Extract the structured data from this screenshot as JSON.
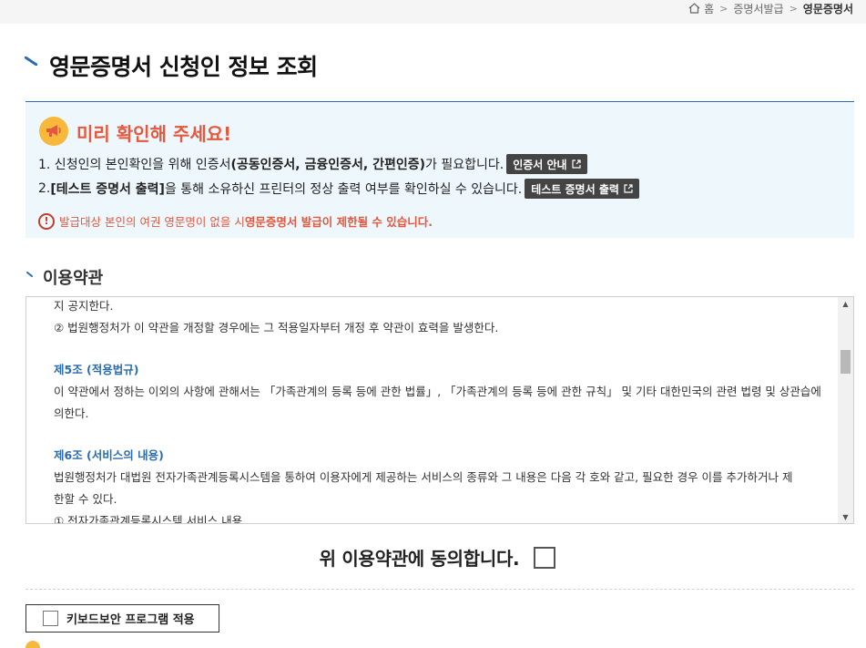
{
  "breadcrumb": {
    "home": "홈",
    "level1": "증명서발급",
    "current": "영문증명서"
  },
  "page": {
    "title": "영문증명서 신청인 정보 조회"
  },
  "notice": {
    "title": "미리 확인해 주세요!",
    "line1_prefix": "1. 신청인의 본인확인을 위해 인증서",
    "line1_bold": "(공동인증서, 금융인증서, 간편인증)",
    "line1_suffix": "가 필요합니다.",
    "cert_button": "인증서 안내",
    "line2_prefix": "2. ",
    "line2_bold": "[테스트 증명서 출력]",
    "line2_suffix": "을 통해 소유하신 프린터의 정상 출력 여부를 확인하실 수 있습니다.",
    "test_button": "테스트 증명서 출력",
    "warn_prefix": "발급대상 본인의 여권 영문명이 없을 시 ",
    "warn_bold": "영문증명서 발급이 제한될 수 있습니다."
  },
  "terms": {
    "section_title": "이용약관",
    "lines": [
      {
        "type": "text",
        "text": "지 공지한다."
      },
      {
        "type": "text",
        "text": "② 법원행정처가 이 약관을 개정할 경우에는 그 적용일자부터 개정 후 약관이 효력을 발생한다."
      },
      {
        "type": "gap",
        "text": ""
      },
      {
        "type": "article",
        "text": "제5조 (적용법규)"
      },
      {
        "type": "text",
        "text": "이 약관에서 정하는 이외의 사항에 관해서는 「가족관계의 등록 등에 관한 법률」, 「가족관계의 등록 등에 관한 규칙」 및 기타 대한민국의 관련 법령 및 상관습에"
      },
      {
        "type": "text",
        "text": "의한다."
      },
      {
        "type": "gap",
        "text": ""
      },
      {
        "type": "article",
        "text": "제6조 (서비스의 내용)"
      },
      {
        "type": "text",
        "text": "법원행정처가 대법원 전자가족관계등록시스템을 통하여 이용자에게 제공하는 서비스의 종류와 그 내용은 다음 각 호와 같고, 필요한 경우 이를 추가하거나 제"
      },
      {
        "type": "text",
        "text": "한할 수 있다."
      },
      {
        "type": "text",
        "text": "① 전자가족관계등록시스템 서비스 내용"
      }
    ]
  },
  "agreement": {
    "label": "위 이용약관에 동의합니다."
  },
  "keyboard": {
    "label": "키보드보안 프로그램 적용"
  },
  "colors": {
    "accent_blue": "#2a6db0",
    "notice_red": "#e4583e",
    "notice_bg": "#eef7fc"
  }
}
